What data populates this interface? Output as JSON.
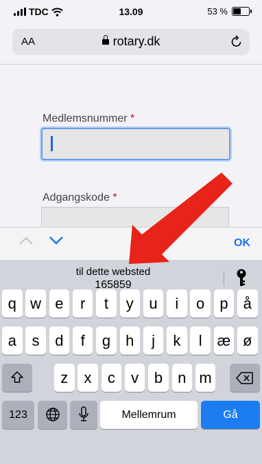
{
  "status_bar": {
    "carrier": "TDC",
    "time": "13.09",
    "battery_percent": "53 %",
    "battery_level": 0.53,
    "icons": [
      "signal-icon",
      "wifi-icon",
      "battery-icon"
    ]
  },
  "browser": {
    "text_size_label": "AA",
    "url": "rotary.dk",
    "icons": [
      "lock-icon",
      "reload-icon"
    ]
  },
  "form": {
    "member_number": {
      "label": "Medlemsnummer",
      "required_mark": "*",
      "value": ""
    },
    "password": {
      "label": "Adgangskode",
      "required_mark": "*",
      "value": ""
    }
  },
  "accessory_bar": {
    "done_label": "OK",
    "icons": [
      "chevron-up-icon",
      "chevron-down-icon"
    ]
  },
  "autofill_suggestion": {
    "line1": "til dette websted",
    "line2": "165859",
    "icon": "key-icon"
  },
  "keyboard": {
    "row1": [
      "q",
      "w",
      "e",
      "r",
      "t",
      "y",
      "u",
      "i",
      "o",
      "p",
      "å"
    ],
    "row2": [
      "a",
      "s",
      "d",
      "f",
      "g",
      "h",
      "j",
      "k",
      "l",
      "æ",
      "ø"
    ],
    "row3": [
      "z",
      "x",
      "c",
      "v",
      "b",
      "n",
      "m"
    ],
    "numbers_key": "123",
    "space_label": "Mellemrum",
    "go_label": "Gå",
    "icons": [
      "shift-icon",
      "backspace-icon",
      "globe-icon",
      "microphone-icon"
    ]
  },
  "colors": {
    "accent": "#1a73e8",
    "arrow": "#e8231a",
    "required": "#d0021b",
    "go_key": "#1c7df2"
  }
}
